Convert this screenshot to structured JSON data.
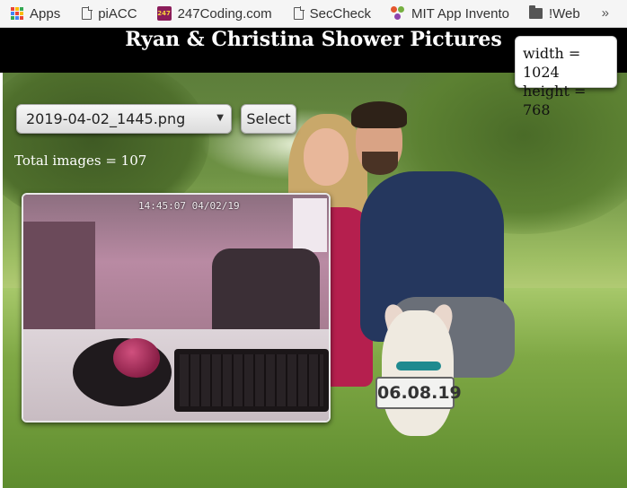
{
  "bookmarks": {
    "items": [
      {
        "label": "Apps",
        "icon": "apps-grid-icon"
      },
      {
        "label": "piACC",
        "icon": "page-icon"
      },
      {
        "label": "247Coding.com",
        "icon": "247coding-icon"
      },
      {
        "label": "SecCheck",
        "icon": "page-icon"
      },
      {
        "label": "MIT App Invento",
        "icon": "mit-app-inventor-icon"
      },
      {
        "label": "!Web",
        "icon": "folder-icon"
      }
    ],
    "overflow": "»"
  },
  "header": {
    "title": "Ryan & Christina Shower Pictures"
  },
  "controls": {
    "selected_image": "2019-04-02_1445.png",
    "select_button": "Select",
    "total_label": "Total images = 107"
  },
  "camera_image": {
    "timestamp": "14:45:07 04/02/19"
  },
  "background_photo": {
    "sign_text": "06.08.19"
  },
  "dimensions": {
    "width_label": "width = 1024",
    "height_label": "height = 768"
  },
  "colors": {
    "header_bg": "#000000",
    "dress": "#b51f4e",
    "shirt": "#25375e",
    "collar": "#1e8a8f"
  }
}
